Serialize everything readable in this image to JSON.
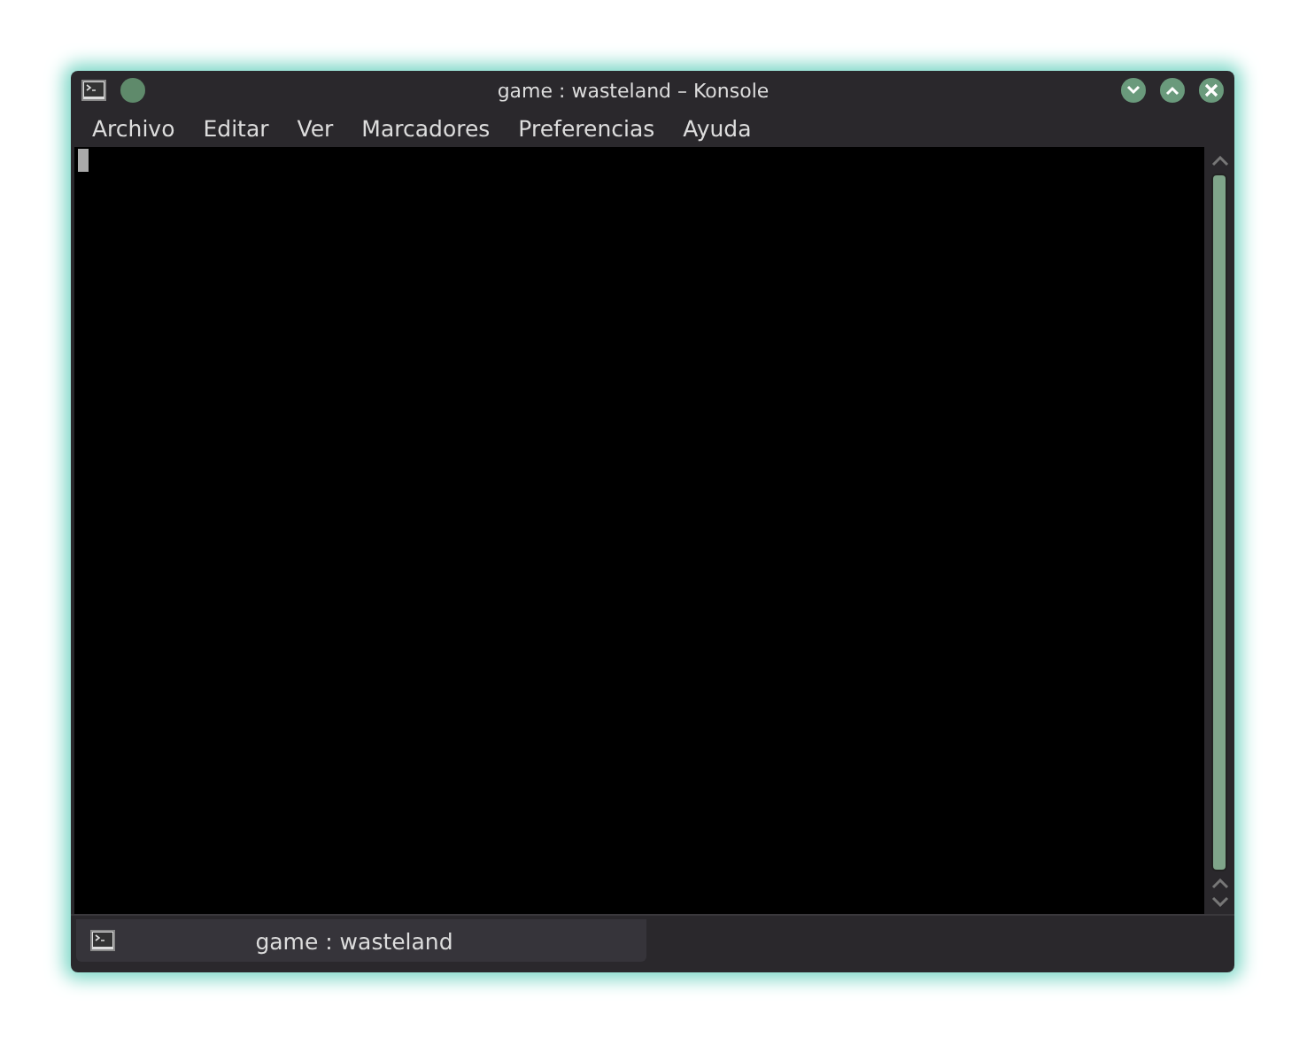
{
  "window": {
    "title": "game : wasteland – Konsole"
  },
  "menu": [
    "Archivo",
    "Editar",
    "Ver",
    "Marcadores",
    "Preferencias",
    "Ayuda"
  ],
  "tabs": [
    {
      "label": "game : wasteland",
      "selected": true
    }
  ]
}
